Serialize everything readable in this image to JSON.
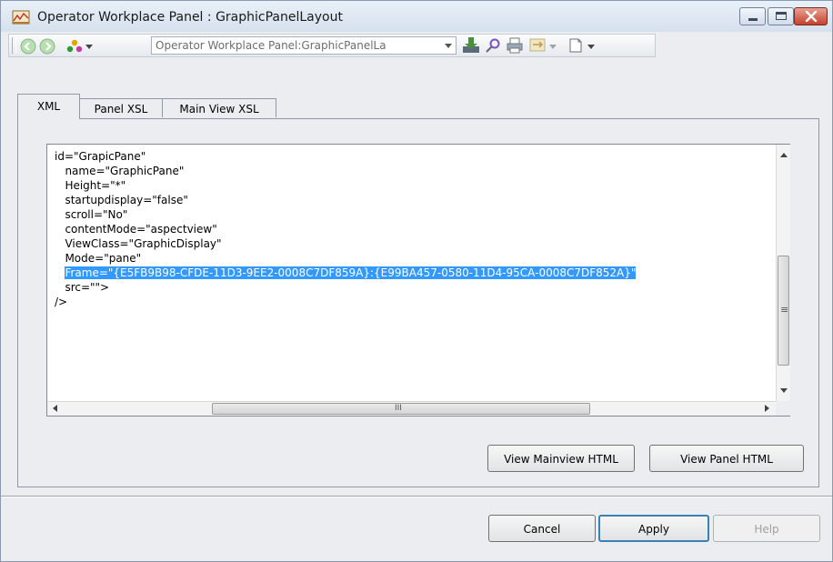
{
  "window": {
    "title": "Operator Workplace Panel : GraphicPanelLayout"
  },
  "toolbar": {
    "address": "Operator Workplace Panel:GraphicPanelLa"
  },
  "tabs": [
    {
      "label": "XML",
      "active": true
    },
    {
      "label": "Panel XSL",
      "active": false
    },
    {
      "label": "Main View XSL",
      "active": false
    }
  ],
  "editor": {
    "lines": [
      "id=\"GrapicPane\"",
      "   name=\"GraphicPane\"",
      "   Height=\"*\"",
      "   startupdisplay=\"false\"",
      "   scroll=\"No\"",
      "   contentMode=\"aspectview\"",
      "   ViewClass=\"GraphicDisplay\"",
      "   Mode=\"pane\""
    ],
    "indent": "   ",
    "selected_line": "Frame=\"{E5FB9B98-CFDE-11D3-9EE2-0008C7DF859A}:{E99BA457-0580-11D4-95CA-0008C7DF852A}\"",
    "lines_after": [
      "   src=\"\">",
      "/>"
    ],
    "hscroll_grip": "III",
    "vscroll_grip": "≡"
  },
  "buttons": {
    "view_mainview_html": "View Mainview HTML",
    "view_panel_html": "View Panel HTML",
    "cancel": "Cancel",
    "apply": "Apply",
    "help": "Help"
  },
  "colors": {
    "selection": "#3399ff",
    "close_button": "#c6412a"
  }
}
